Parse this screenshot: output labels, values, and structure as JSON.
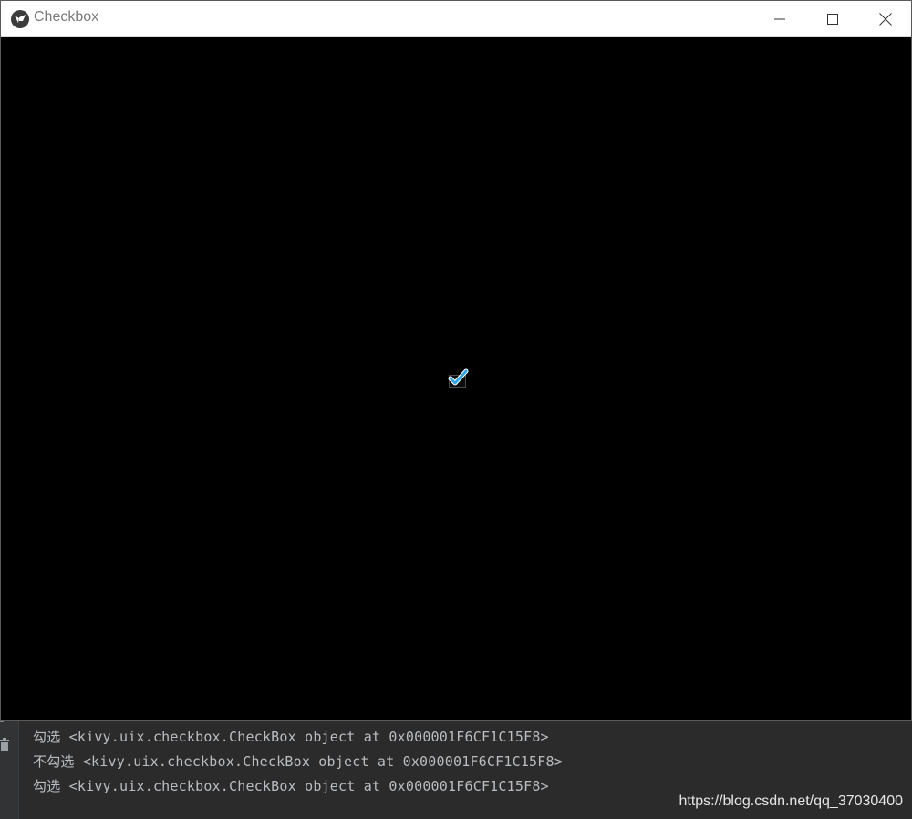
{
  "window": {
    "title": "Checkbox",
    "icons": {
      "app": "kivy-logo-icon",
      "minimize": "minimize-icon",
      "maximize": "maximize-icon",
      "close": "close-icon"
    }
  },
  "checkbox": {
    "checked": true,
    "accent_color": "#33a7e6"
  },
  "console": {
    "lines": [
      "勾选 <kivy.uix.checkbox.CheckBox object at 0x000001F6CF1C15F8>",
      "不勾选 <kivy.uix.checkbox.CheckBox object at 0x000001F6CF1C15F8>",
      "勾选 <kivy.uix.checkbox.CheckBox object at 0x000001F6CF1C15F8>"
    ],
    "gutter_icon": "trash-icon"
  },
  "watermark": "https://blog.csdn.net/qq_37030400"
}
